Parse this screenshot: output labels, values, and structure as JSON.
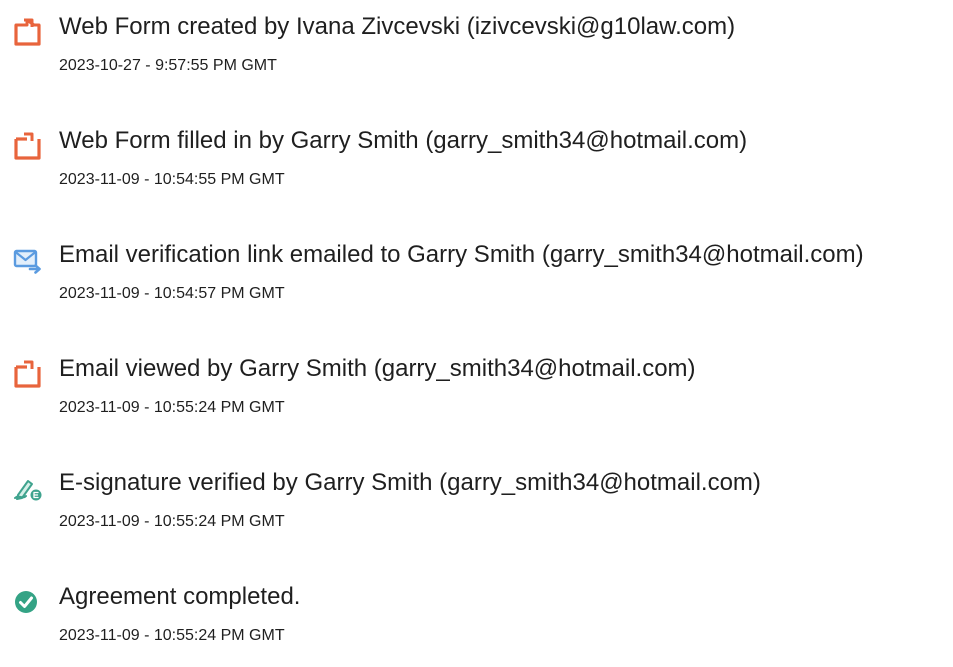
{
  "events": [
    {
      "icon": "document-icon",
      "title": "Web Form created by Ivana Zivcevski (izivcevski@g10law.com)",
      "timestamp": "2023-10-27 - 9:57:55 PM GMT"
    },
    {
      "icon": "document-icon",
      "title": "Web Form filled in by Garry Smith (garry_smith34@hotmail.com)",
      "timestamp": "2023-11-09 - 10:54:55 PM GMT"
    },
    {
      "icon": "email-send-icon",
      "title": "Email verification link emailed to Garry Smith (garry_smith34@hotmail.com)",
      "timestamp": "2023-11-09 - 10:54:57 PM GMT"
    },
    {
      "icon": "document-icon",
      "title": "Email viewed by Garry Smith (garry_smith34@hotmail.com)",
      "timestamp": "2023-11-09 - 10:55:24 PM GMT"
    },
    {
      "icon": "e-signature-icon",
      "title": "E-signature verified by Garry Smith (garry_smith34@hotmail.com)",
      "timestamp": "2023-11-09 - 10:55:24 PM GMT"
    },
    {
      "icon": "checkmark-circle-icon",
      "title": "Agreement completed.",
      "timestamp": "2023-11-09 - 10:55:24 PM GMT"
    }
  ],
  "colors": {
    "document_icon": "#e8643c",
    "email_icon": "#5b9be0",
    "signature_icon": "#3fa38e",
    "check_icon": "#34a385",
    "text": "#1f1f1f"
  }
}
